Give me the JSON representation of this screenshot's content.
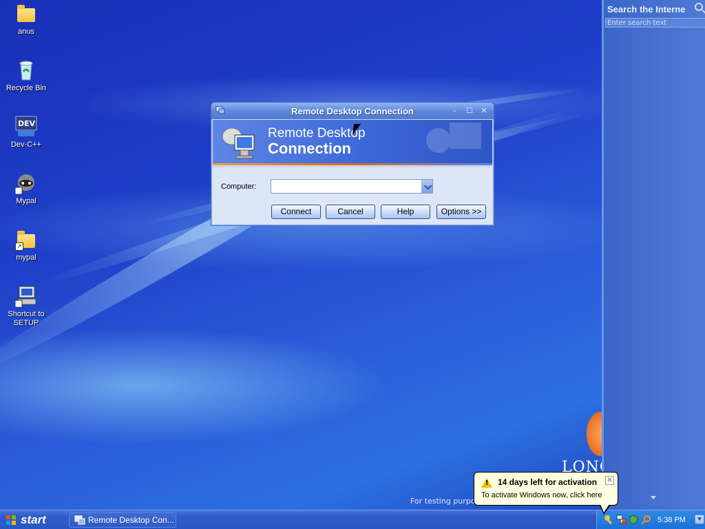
{
  "desktop": {
    "icons": [
      {
        "label": "anus",
        "icon": "folder-icon"
      },
      {
        "label": "Recycle Bin",
        "icon": "recycle-bin-icon"
      },
      {
        "label": "Dev-C++",
        "icon": "dev-cpp-icon"
      },
      {
        "label": "Mypal",
        "icon": "mypal-icon"
      },
      {
        "label": "mypal",
        "icon": "folder-shortcut-icon"
      },
      {
        "label": "Shortcut to SETUP",
        "icon": "setup-shortcut-icon"
      }
    ],
    "watermark_brand": "LONG",
    "testing_text": "For testing purpose"
  },
  "sidepane": {
    "title": "Search the Interne",
    "search_placeholder": "Enter search text"
  },
  "window": {
    "title": "Remote Desktop Connection",
    "banner_line1": "Remote Desktop",
    "banner_line2": "Connection",
    "computer_label": "Computer:",
    "computer_value": "",
    "buttons": {
      "connect": "Connect",
      "cancel": "Cancel",
      "help": "Help",
      "options": "Options >>"
    }
  },
  "taskbar": {
    "start_label": "start",
    "task_label": "Remote Desktop Con...",
    "clock": "5:38 PM"
  },
  "balloon": {
    "title": "14 days left for activation",
    "text": "To activate Windows now, click here"
  },
  "colors": {
    "title_bar": "#5f88dc",
    "taskbar": "#2856c4",
    "tray": "#1b6fd8",
    "balloon_bg": "#ffffe1"
  }
}
